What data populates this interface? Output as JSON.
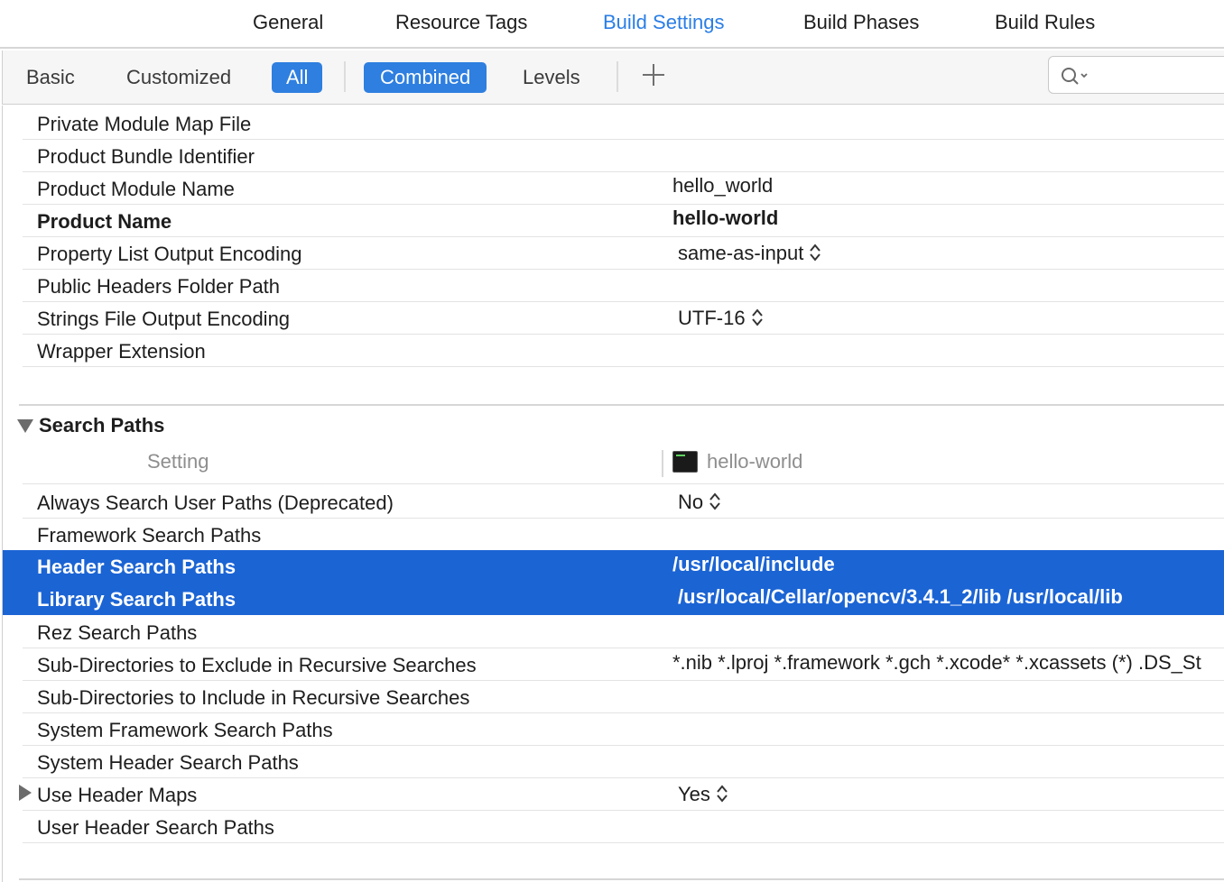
{
  "top_tabs": [
    "General",
    "Resource Tags",
    "Build Settings",
    "Build Phases",
    "Build Rules"
  ],
  "active_top_tab": "Build Settings",
  "filter": {
    "basic": "Basic",
    "customized": "Customized",
    "all": "All",
    "combined": "Combined",
    "levels": "Levels",
    "search_placeholder": ""
  },
  "rows_top": [
    {
      "name": "Private Module Map File",
      "value": ""
    },
    {
      "name": "Product Bundle Identifier",
      "value": ""
    },
    {
      "name": "Product Module Name",
      "value": "hello_world"
    },
    {
      "name": "Product Name",
      "value": "hello-world",
      "bold": true
    },
    {
      "name": "Property List Output Encoding",
      "value": "same-as-input",
      "enum": true
    },
    {
      "name": "Public Headers Folder Path",
      "value": ""
    },
    {
      "name": "Strings File Output Encoding",
      "value": "UTF-16",
      "enum": true
    },
    {
      "name": "Wrapper Extension",
      "value": ""
    }
  ],
  "search_paths": {
    "title": "Search Paths",
    "col_setting": "Setting",
    "col_target": "hello-world",
    "rows": [
      {
        "name": "Always Search User Paths (Deprecated)",
        "value": "No",
        "enum": true
      },
      {
        "name": "Framework Search Paths",
        "value": ""
      },
      {
        "name": "Header Search Paths",
        "value": "/usr/local/include",
        "selected": true
      },
      {
        "name": "Library Search Paths",
        "value": "/usr/local/Cellar/opencv/3.4.1_2/lib /usr/local/lib",
        "selected": true
      },
      {
        "name": "Rez Search Paths",
        "value": ""
      },
      {
        "name": "Sub-Directories to Exclude in Recursive Searches",
        "value": "*.nib *.lproj *.framework *.gch *.xcode* *.xcassets (*) .DS_St"
      },
      {
        "name": "Sub-Directories to Include in Recursive Searches",
        "value": ""
      },
      {
        "name": "System Framework Search Paths",
        "value": ""
      },
      {
        "name": "System Header Search Paths",
        "value": ""
      },
      {
        "name": "Use Header Maps",
        "value": "Yes",
        "enum": true,
        "expandable": true
      },
      {
        "name": "User Header Search Paths",
        "value": ""
      }
    ]
  },
  "colors": {
    "accent": "#2e7fe0",
    "selection": "#1b64d4",
    "active_tab": "#2a7ee6"
  }
}
